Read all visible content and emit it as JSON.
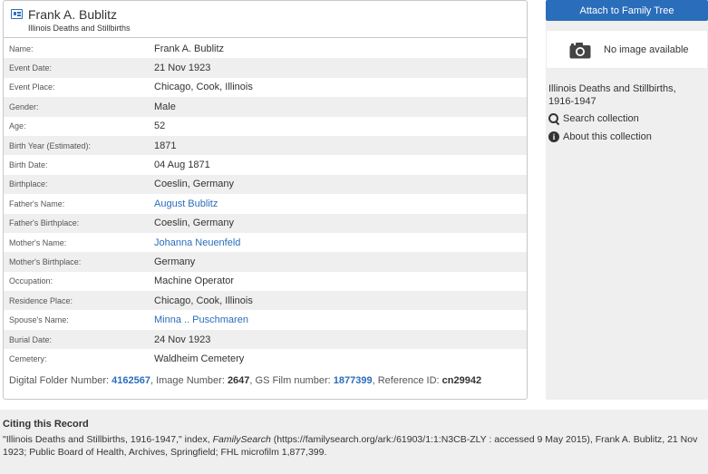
{
  "record": {
    "title": "Frank A. Bublitz",
    "subtitle": "Illinois Deaths and Stillbirths",
    "fields": [
      {
        "label": "Name:",
        "value": "Frank A. Bublitz",
        "link": false
      },
      {
        "label": "Event Date:",
        "value": "21 Nov 1923",
        "link": false
      },
      {
        "label": "Event Place:",
        "value": "Chicago, Cook, Illinois",
        "link": false
      },
      {
        "label": "Gender:",
        "value": "Male",
        "link": false
      },
      {
        "label": "Age:",
        "value": "52",
        "link": false
      },
      {
        "label": "Birth Year (Estimated):",
        "value": "1871",
        "link": false
      },
      {
        "label": "Birth Date:",
        "value": "04 Aug 1871",
        "link": false
      },
      {
        "label": "Birthplace:",
        "value": "Coeslin, Germany",
        "link": false
      },
      {
        "label": "Father's Name:",
        "value": "August Bublitz",
        "link": true
      },
      {
        "label": "Father's Birthplace:",
        "value": "Coeslin, Germany",
        "link": false
      },
      {
        "label": "Mother's Name:",
        "value": "Johanna Neuenfeld",
        "link": true
      },
      {
        "label": "Mother's Birthplace:",
        "value": "Germany",
        "link": false
      },
      {
        "label": "Occupation:",
        "value": "Machine Operator",
        "link": false
      },
      {
        "label": "Residence Place:",
        "value": "Chicago, Cook, Illinois",
        "link": false
      },
      {
        "label": "Spouse's Name:",
        "value": "Minna .. Puschmaren",
        "link": true
      },
      {
        "label": "Burial Date:",
        "value": "24 Nov 1923",
        "link": false
      },
      {
        "label": "Cemetery:",
        "value": "Waldheim Cemetery",
        "link": false
      }
    ],
    "folder": {
      "digital_folder_label": "Digital Folder Number:",
      "digital_folder_value": "4162567",
      "image_number_label": "Image Number:",
      "image_number_value": "2647",
      "gs_film_label": "GS Film number:",
      "gs_film_value": "1877399",
      "reference_label": "Reference ID:",
      "reference_value": "cn29942"
    }
  },
  "sidebar": {
    "attach_label": "Attach to Family Tree",
    "no_image_label": "No image available",
    "collection_title": "Illinois Deaths and Stillbirths, 1916-1947",
    "search_label": "Search collection",
    "about_label": "About this collection"
  },
  "citing": {
    "title": "Citing this Record",
    "text_before": "\"Illinois Deaths and Stillbirths, 1916-1947,\" index, ",
    "source": "FamilySearch",
    "text_after": " (https://familysearch.org/ark:/61903/1:1:N3CB-ZLY : accessed 9 May 2015), Frank A. Bublitz, 21 Nov 1923; Public Board of Health, Archives, Springfield; FHL microfilm 1,877,399."
  },
  "colors": {
    "accent": "#2a6ebb",
    "row_stripe": "#efefef"
  }
}
